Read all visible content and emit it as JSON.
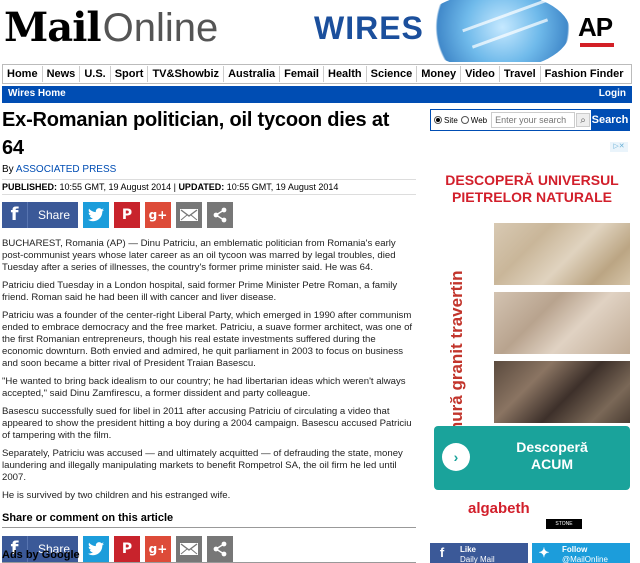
{
  "masthead": {
    "logo_bold": "Mail",
    "logo_light": "Online",
    "wires_label": "WIRES",
    "ap_label": "AP"
  },
  "nav": {
    "items": [
      "Home",
      "News",
      "U.S.",
      "Sport",
      "TV&Showbiz",
      "Australia",
      "Femail",
      "Health",
      "Science",
      "Money",
      "Video",
      "Travel",
      "Fashion Finder"
    ]
  },
  "bar": {
    "left": "Wires Home",
    "right": "Login"
  },
  "article": {
    "headline": "Ex-Romanian politician, oil tycoon dies at 64",
    "by_prefix": "By ",
    "by_source": "ASSOCIATED PRESS",
    "published_label": "PUBLISHED:",
    "published": " 10:55 GMT, 19 August 2014 | ",
    "updated_label": "UPDATED:",
    "updated": " 10:55 GMT, 19 August 2014",
    "paragraphs": [
      "BUCHAREST, Romania (AP) — Dinu Patriciu, an emblematic politician from Romania's early post-communist years whose later career as an oil tycoon was marred by legal troubles, died Tuesday after a series of illnesses, the country's former prime minister said. He was 64.",
      "Patriciu died Tuesday in a London hospital, said former Prime Minister Petre Roman, a family friend. Roman said he had been ill with cancer and liver disease.",
      "Patriciu was a founder of the center-right Liberal Party, which emerged in 1990 after communism ended to embrace democracy and the free market. Patriciu, a suave former architect, was one of the first Romanian entrepreneurs, though his real estate investments suffered during the economic downturn. Both envied and admired, he quit parliament in 2003 to focus on business and soon became a bitter rival of President Traian Basescu.",
      "\"He wanted to bring back idealism to our country; he had libertarian ideas which weren't always accepted,\" said Dinu Zamfirescu, a former dissident and party colleague.",
      "Basescu successfully sued for libel in 2011 after accusing Patriciu of circulating a video that appeared to show the president hitting a boy during a 2004 campaign. Basescu accused Patriciu of tampering with the film.",
      "Separately, Patriciu was accused — and ultimately acquitted — of defrauding the state, money laundering and illegally manipulating markets to benefit Rompetrol SA, the oil firm he led until 2007.",
      "He is survived by two children and his estranged wife."
    ],
    "comment_heading": "Share or comment on this article",
    "ads_heading": "Ads by Google"
  },
  "share": {
    "facebook_label": "Share",
    "gplus_label": "g+"
  },
  "search": {
    "site_label": "Site",
    "web_label": "Web",
    "placeholder": "Enter your search",
    "button": "Search"
  },
  "ad": {
    "title": "DESCOPERĂ UNIVERSUL PIETRELOR NATURALE",
    "vertical_text": "marmură granit travertin",
    "button_line1": "Descoperă",
    "button_line2": "ACUM",
    "brand": "algabeth",
    "brand_sub": "STONE GROUP"
  },
  "follow": {
    "fb_line1": "Like",
    "fb_line2": "Daily Mail",
    "tw_line1": "Follow",
    "tw_line2": "@MailOnline"
  },
  "colors": {
    "brand_blue": "#004db3",
    "facebook": "#3b5998",
    "twitter": "#1c9ddb",
    "pinterest": "#c8232c",
    "gplus": "#dd4b39",
    "ad_red": "#d21f2b",
    "ad_teal": "#1aa39b"
  },
  "icons": [
    "facebook-icon",
    "twitter-icon",
    "pinterest-icon",
    "google-plus-icon",
    "email-icon",
    "share-icon",
    "search-icon",
    "adchoices-icon"
  ]
}
